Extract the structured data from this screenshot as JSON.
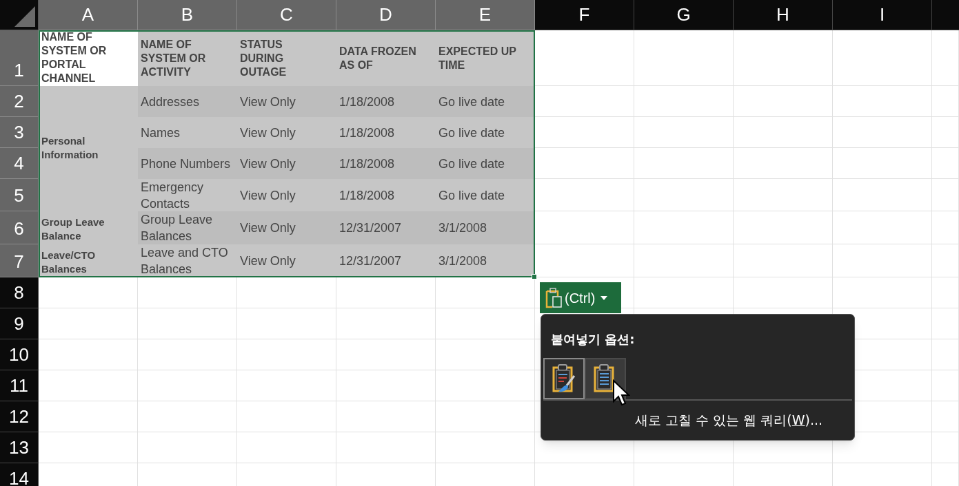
{
  "columns": [
    {
      "label": "A",
      "selected": true
    },
    {
      "label": "B",
      "selected": true
    },
    {
      "label": "C",
      "selected": true
    },
    {
      "label": "D",
      "selected": true
    },
    {
      "label": "E",
      "selected": true
    },
    {
      "label": "F",
      "selected": false
    },
    {
      "label": "G",
      "selected": false
    },
    {
      "label": "H",
      "selected": false
    },
    {
      "label": "I",
      "selected": false
    }
  ],
  "rows": [
    {
      "label": "1",
      "selected": true
    },
    {
      "label": "2",
      "selected": true
    },
    {
      "label": "3",
      "selected": true
    },
    {
      "label": "4",
      "selected": true
    },
    {
      "label": "5",
      "selected": true
    },
    {
      "label": "6",
      "selected": true
    },
    {
      "label": "7",
      "selected": true
    },
    {
      "label": "8",
      "selected": false
    },
    {
      "label": "9",
      "selected": false
    },
    {
      "label": "10",
      "selected": false
    },
    {
      "label": "11",
      "selected": false
    },
    {
      "label": "12",
      "selected": false
    },
    {
      "label": "13",
      "selected": false
    },
    {
      "label": "14",
      "selected": false
    }
  ],
  "table": {
    "header": [
      "NAME OF SYSTEM OR PORTAL CHANNEL",
      "NAME OF SYSTEM OR ACTIVITY",
      "STATUS DURING OUTAGE",
      "DATA FROZEN AS OF",
      "EXPECTED UP TIME"
    ],
    "groups": [
      {
        "label": "Personal Information",
        "rows": [
          [
            "Addresses",
            "View Only",
            "1/18/2008",
            "Go live date"
          ],
          [
            "Names",
            "View Only",
            "1/18/2008",
            "Go live date"
          ],
          [
            "Phone Numbers",
            "View Only",
            "1/18/2008",
            "Go live date"
          ],
          [
            "Emergency Contacts",
            "View Only",
            "1/18/2008",
            "Go live date"
          ]
        ]
      },
      {
        "label": "Group Leave Balance",
        "rows": [
          [
            "Group Leave Balances",
            "View Only",
            "12/31/2007",
            "3/1/2008"
          ]
        ]
      },
      {
        "label": "Leave/CTO Balances",
        "rows": [
          [
            "Leave and CTO Balances",
            "View Only",
            "12/31/2007",
            "3/1/2008"
          ]
        ]
      }
    ]
  },
  "paste_button": {
    "label": "(Ctrl)"
  },
  "paste_menu": {
    "title": "붙여넣기 옵션:",
    "options": [
      {
        "kind": "keep-formatting",
        "selected": true
      },
      {
        "kind": "match-destination",
        "selected": false
      }
    ],
    "item": {
      "before": "새로 고칠 수 있는 웹 쿼리(",
      "mnemonic": "W",
      "after": ")..."
    }
  }
}
